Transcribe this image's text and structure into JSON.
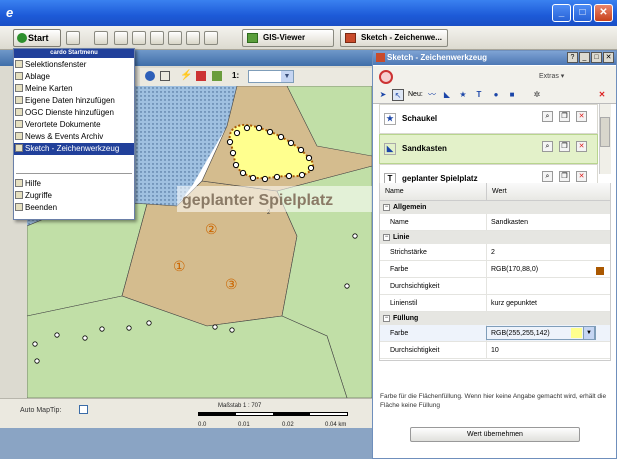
{
  "toolbar": {
    "start_label": "Start",
    "tasks": [
      "GIS-Viewer",
      "Sketch - Zeichenwe..."
    ]
  },
  "start_menu": {
    "header": "cardo Startmenu",
    "items": [
      "Selektionsfenster",
      "Ablage",
      "Meine Karten",
      "Eigene Daten hinzufügen",
      "OGC Dienste hinzufügen",
      "Verortete Dokumente",
      "News & Events Archiv",
      "Sketch - Zeichenwerkzeug"
    ],
    "selected": "Sketch - Zeichenwerkzeug",
    "items2": [
      "Hilfe",
      "Zugriffe",
      "Beenden"
    ]
  },
  "map": {
    "scale_prefix": "1:",
    "label_spielplatz": "geplanter Spielplatz",
    "area_numbers": [
      "①",
      "②",
      "③"
    ],
    "small_label": "2",
    "auto_maptip_label": "Auto MapTip:",
    "scale_text": "Maßstab 1 : 707",
    "scale_ticks": [
      "0.0",
      "0.01",
      "0.02",
      "0.04 km"
    ]
  },
  "sketch": {
    "title": "Sketch - Zeichenwerkzeug",
    "extras_label": "Extras",
    "new_label": "Neu:",
    "items": [
      {
        "label": "Schaukel",
        "icon": "star-icon"
      },
      {
        "label": "Sandkasten",
        "icon": "area-icon"
      },
      {
        "label": "geplanter Spielplatz",
        "icon": "text-icon"
      }
    ],
    "selected_item": "Sandkasten",
    "table_headers": {
      "name": "Name",
      "value": "Wert"
    },
    "groups": [
      {
        "title": "Allgemein",
        "rows": [
          {
            "name": "Name",
            "value": "Sandkasten"
          }
        ]
      },
      {
        "title": "Linie",
        "rows": [
          {
            "name": "Strichstärke",
            "value": "2"
          },
          {
            "name": "Farbe",
            "value": "RGB(170,88,0)"
          },
          {
            "name": "Durchsichtigkeit",
            "value": ""
          },
          {
            "name": "Linienstil",
            "value": "kurz gepunktet"
          }
        ]
      },
      {
        "title": "Füllung",
        "rows": [
          {
            "name": "Farbe",
            "value": "RGB(255,255,142)"
          },
          {
            "name": "Durchsichtigkeit",
            "value": "10"
          }
        ]
      }
    ],
    "description": "Farbe für die Flächenfüllung. Wenn hier keine Angabe gemacht wird, erhält die Fläche keine Füllung",
    "apply_label": "Wert übernehmen",
    "colors": {
      "line": "#aa5800",
      "fill": "#ffff8e"
    }
  }
}
